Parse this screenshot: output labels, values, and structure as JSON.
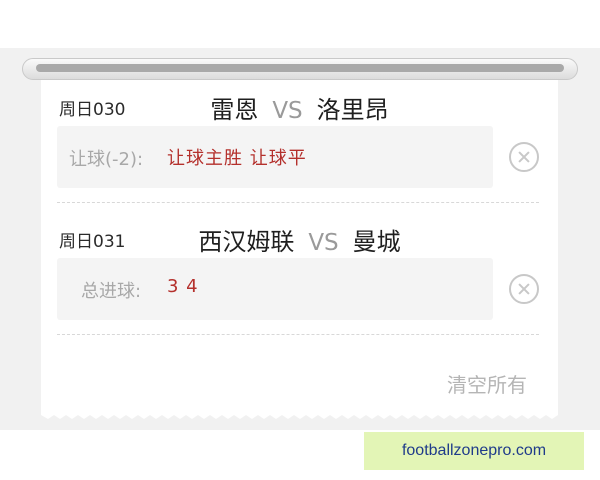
{
  "matches": [
    {
      "id_label": "周日030",
      "home": "雷恩",
      "vs": "VS",
      "away": "洛里昂",
      "bet_label": "让球(-2):",
      "bet_value": "让球主胜 让球平"
    },
    {
      "id_label": "周日031",
      "home": "西汉姆联",
      "vs": "VS",
      "away": "曼城",
      "bet_label": "总进球:",
      "bet_value": "3 4"
    }
  ],
  "footer": {
    "clear_all": "清空所有"
  },
  "watermark": {
    "text": "footballzonepro.com"
  },
  "colors": {
    "accent_red": "#b4302c",
    "muted_gray": "#a8a8a8",
    "watermark_bg": "#e3f5b6"
  }
}
